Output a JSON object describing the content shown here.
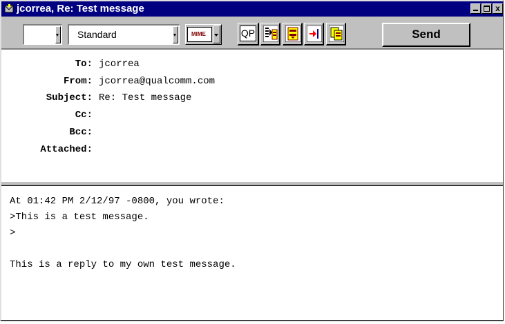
{
  "window": {
    "title": "jcorrea, Re: Test message"
  },
  "toolbar": {
    "combo_empty": "",
    "style_combo": "Standard",
    "encoding_label": "MIME",
    "qp_label": "QP",
    "send_label": "Send",
    "icons": [
      "text-as-attachment-icon",
      "word-wrap-icon",
      "tabs-in-body-icon",
      "keep-copy-icon"
    ]
  },
  "headers": {
    "to_label": "To:",
    "to_value": "jcorrea",
    "from_label": "From:",
    "from_value": "jcorrea@qualcomm.com",
    "subject_label": "Subject:",
    "subject_value": "Re: Test message",
    "cc_label": "Cc:",
    "cc_value": "",
    "bcc_label": "Bcc:",
    "bcc_value": "",
    "attached_label": "Attached:",
    "attached_value": ""
  },
  "body": {
    "lines": [
      "At 01:42 PM 2/12/97 -0800, you wrote:",
      ">This is a test message.",
      ">",
      "",
      "This is a reply to my own test message."
    ]
  }
}
